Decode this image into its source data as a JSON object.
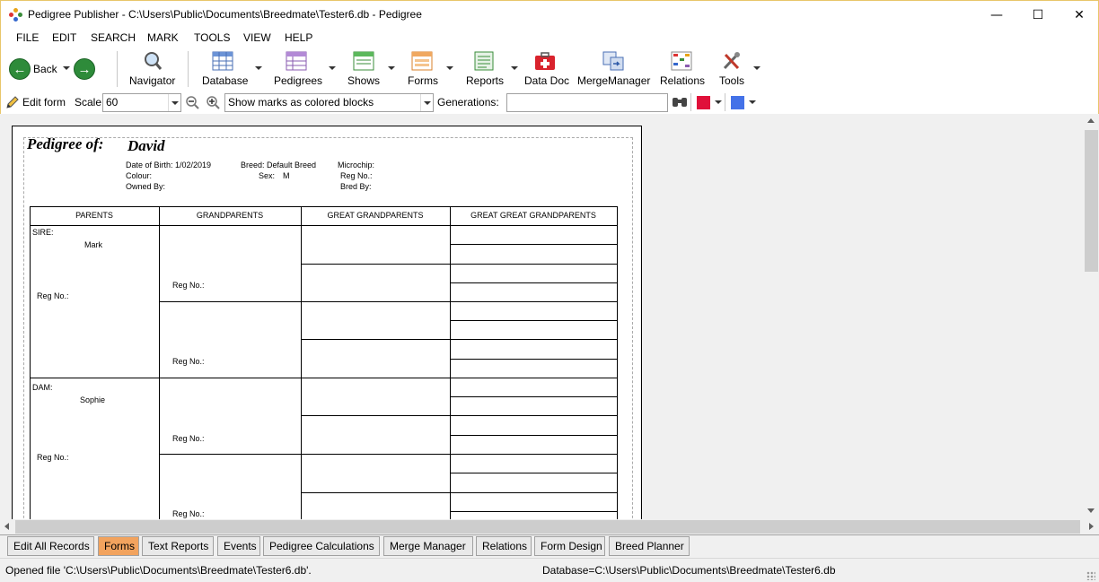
{
  "window": {
    "title": "Pedigree Publisher - C:\\Users\\Public\\Documents\\Breedmate\\Tester6.db - Pedigree"
  },
  "menu": [
    "FILE",
    "EDIT",
    "SEARCH",
    "MARK",
    "TOOLS",
    "VIEW",
    "HELP"
  ],
  "toolbar": {
    "back": "Back",
    "navigator": "Navigator",
    "database": "Database",
    "pedigrees": "Pedigrees",
    "shows": "Shows",
    "forms": "Forms",
    "reports": "Reports",
    "datadoc": "Data Doc",
    "mergemanager": "MergeManager",
    "relations": "Relations",
    "tools": "Tools"
  },
  "formbar": {
    "edit_form": "Edit form",
    "scale_label": "Scale",
    "scale_value": "60",
    "marks_mode": "Show marks as colored blocks",
    "generations_label": "Generations:",
    "generations_value": "",
    "color1": "#e0103a",
    "color2": "#4472e8"
  },
  "pedigree": {
    "heading": "Pedigree of:",
    "name": "David",
    "dob": "Date of Birth: 1/02/2019",
    "colour": "Colour:",
    "owned": "Owned By:",
    "breed": "Breed: Default Breed",
    "sex_label": "Sex:",
    "sex_value": "M",
    "microchip": "Microchip:",
    "regno": "Reg No.:",
    "bredby": "Bred By:",
    "columns": [
      "PARENTS",
      "GRANDPARENTS",
      "GREAT GRANDPARENTS",
      "GREAT GREAT GRANDPARENTS"
    ],
    "sire_label": "SIRE:",
    "sire_name": "Mark",
    "dam_label": "DAM:",
    "dam_name": "Sophie",
    "reg_label": "Reg No.:"
  },
  "tabs": [
    "Edit All Records",
    "Forms",
    "Text Reports",
    "Events",
    "Pedigree Calculations",
    "Merge Manager",
    "Relations",
    "Form Design",
    "Breed Planner"
  ],
  "active_tab": "Forms",
  "status": {
    "left": "Opened file 'C:\\Users\\Public\\Documents\\Breedmate\\Tester6.db'.",
    "right": "Database=C:\\Users\\Public\\Documents\\Breedmate\\Tester6.db"
  }
}
